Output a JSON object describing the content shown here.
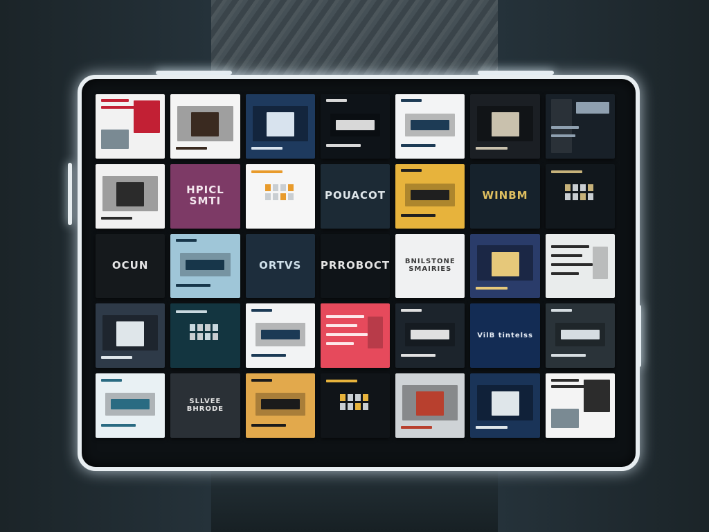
{
  "wall": {
    "colors": {
      "frame": "#e8eef1",
      "background": "#1a2226"
    },
    "tiles": [
      {
        "title": "",
        "bg": "#f2f2f2",
        "fg": "#c22034",
        "style": "news"
      },
      {
        "title": "",
        "bg": "#f4f4f4",
        "fg": "#3a2a20",
        "style": "photo"
      },
      {
        "title": "",
        "bg": "#1e3a5e",
        "fg": "#d8e3ee",
        "style": "photo"
      },
      {
        "title": "",
        "bg": "#0e1318",
        "fg": "#d8d8d8",
        "style": "card"
      },
      {
        "title": "",
        "bg": "#f3f4f5",
        "fg": "#1d3b55",
        "style": "card"
      },
      {
        "title": "",
        "bg": "#1b1f24",
        "fg": "#c9c1ad",
        "style": "photo"
      },
      {
        "title": "",
        "bg": "#182028",
        "fg": "#8fa0b0",
        "style": "dark"
      },
      {
        "title": "",
        "bg": "#f1f1f1",
        "fg": "#2b2b2b",
        "style": "photo"
      },
      {
        "title": "HPICL SMTI",
        "bg": "#7d3a66",
        "fg": "#f4e6ee",
        "style": "title"
      },
      {
        "title": "",
        "bg": "#f6f6f6",
        "fg": "#e89b2c",
        "style": "dots"
      },
      {
        "title": "POUACOT",
        "bg": "#1c2a35",
        "fg": "#dfe6ea",
        "style": "title"
      },
      {
        "title": "",
        "bg": "#e7b33c",
        "fg": "#1f1f1f",
        "style": "card"
      },
      {
        "title": "WINBM",
        "bg": "#16222c",
        "fg": "#e0c060",
        "style": "titledark"
      },
      {
        "title": "",
        "bg": "#11171c",
        "fg": "#c7b27a",
        "style": "dots"
      },
      {
        "title": "OCUN",
        "bg": "#15191c",
        "fg": "#e6e6e6",
        "style": "title"
      },
      {
        "title": "",
        "bg": "#9fc6d8",
        "fg": "#17364a",
        "style": "card"
      },
      {
        "title": "ORTVS",
        "bg": "#1d2d3c",
        "fg": "#cfe0ea",
        "style": "title"
      },
      {
        "title": "PRROBOCT",
        "bg": "#0f1418",
        "fg": "#e4e4e4",
        "style": "title"
      },
      {
        "title": "BNILSTONE SMAIRIES",
        "bg": "#f0f1f2",
        "fg": "#3a3a3a",
        "style": "titlelight"
      },
      {
        "title": "",
        "bg": "#2a3c6a",
        "fg": "#e6c87a",
        "style": "photo"
      },
      {
        "title": "",
        "bg": "#e9ecec",
        "fg": "#2b2b2b",
        "style": "list"
      },
      {
        "title": "",
        "bg": "#2e3a48",
        "fg": "#dfe6ea",
        "style": "photo"
      },
      {
        "title": "",
        "bg": "#133540",
        "fg": "#c9d8df",
        "style": "dots"
      },
      {
        "title": "",
        "bg": "#f2f3f4",
        "fg": "#1c3a55",
        "style": "card"
      },
      {
        "title": "",
        "bg": "#e64a5c",
        "fg": "#fde8ea",
        "style": "list"
      },
      {
        "title": "",
        "bg": "#1c242c",
        "fg": "#e0e0e0",
        "style": "card"
      },
      {
        "title": "VilB tintelss",
        "bg": "#132c54",
        "fg": "#e8eef6",
        "style": "titledark"
      },
      {
        "title": "",
        "bg": "#2a3339",
        "fg": "#d6dde1",
        "style": "card"
      },
      {
        "title": "",
        "bg": "#e9f1f4",
        "fg": "#2a6b82",
        "style": "card"
      },
      {
        "title": "SLLVEE BHRODE",
        "bg": "#2a3036",
        "fg": "#e6e6e6",
        "style": "titledark"
      },
      {
        "title": "",
        "bg": "#e2a94c",
        "fg": "#1b1b1b",
        "style": "card"
      },
      {
        "title": "",
        "bg": "#101418",
        "fg": "#e7b33c",
        "style": "dots"
      },
      {
        "title": "",
        "bg": "#cfd3d6",
        "fg": "#b8402e",
        "style": "photo"
      },
      {
        "title": "",
        "bg": "#1a3458",
        "fg": "#dfe6ea",
        "style": "photo"
      },
      {
        "title": "",
        "bg": "#f4f4f4",
        "fg": "#2c2c2c",
        "style": "news"
      }
    ]
  }
}
